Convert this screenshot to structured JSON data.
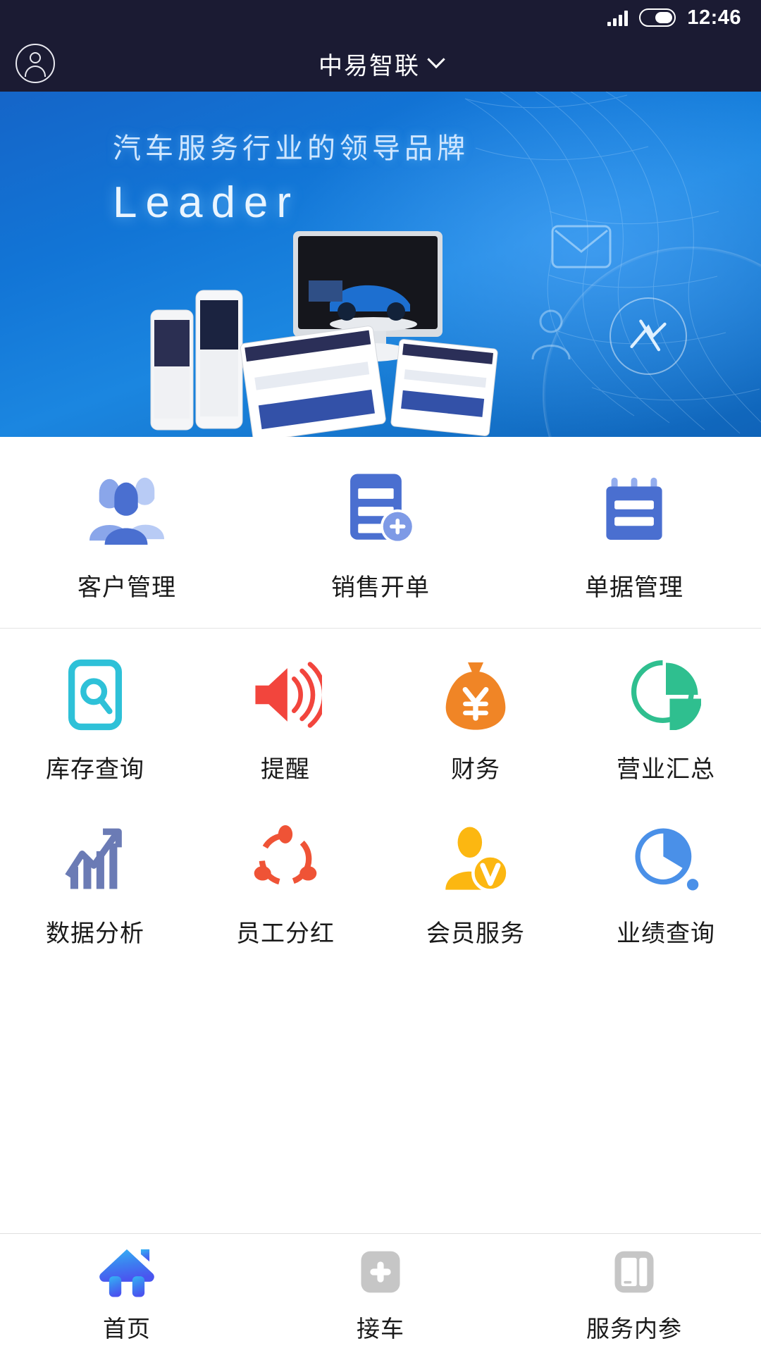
{
  "status_bar": {
    "time": "12:46",
    "signal_icon": "signal-bars-icon",
    "battery_icon": "battery-icon",
    "battery_level_percent": 58
  },
  "header": {
    "title": "中易智联",
    "avatar_icon": "user-avatar-icon",
    "dropdown_icon": "chevron-down-icon",
    "background_color": "#1b1b33"
  },
  "banner": {
    "subtitle": "汽车服务行业的领导品牌",
    "title": "Leader",
    "accent_color": "#1275d6"
  },
  "sections": [
    {
      "name": "primary",
      "items": [
        {
          "label": "客户管理",
          "icon": "customers-icon",
          "color": "#4a6fd0"
        },
        {
          "label": "销售开单",
          "icon": "sales-invoice-icon",
          "color": "#4a6fd0"
        },
        {
          "label": "单据管理",
          "icon": "notepad-icon",
          "color": "#4a6fd0"
        }
      ]
    },
    {
      "name": "secondary",
      "rows": [
        [
          {
            "label": "库存查询",
            "icon": "inventory-search-icon",
            "color": "#2ec1d8"
          },
          {
            "label": "提醒",
            "icon": "speaker-alert-icon",
            "color": "#f2453d"
          },
          {
            "label": "财务",
            "icon": "money-bag-icon",
            "color": "#f08526"
          },
          {
            "label": "营业汇总",
            "icon": "pie-chart-icon",
            "color": "#2fbf8f"
          }
        ],
        [
          {
            "label": "数据分析",
            "icon": "bar-chart-trend-icon",
            "color": "#6b7bb5"
          },
          {
            "label": "员工分红",
            "icon": "share-nodes-icon",
            "color": "#ef5336"
          },
          {
            "label": "会员服务",
            "icon": "member-badge-icon",
            "color": "#fcb711"
          },
          {
            "label": "业绩查询",
            "icon": "performance-pie-icon",
            "color": "#4a90e8"
          }
        ]
      ]
    }
  ],
  "tabbar": {
    "active_index": 0,
    "items": [
      {
        "label": "首页",
        "icon": "home-icon",
        "active": true
      },
      {
        "label": "接车",
        "icon": "plus-icon",
        "active": false
      },
      {
        "label": "服务内参",
        "icon": "book-icon",
        "active": false
      }
    ]
  }
}
